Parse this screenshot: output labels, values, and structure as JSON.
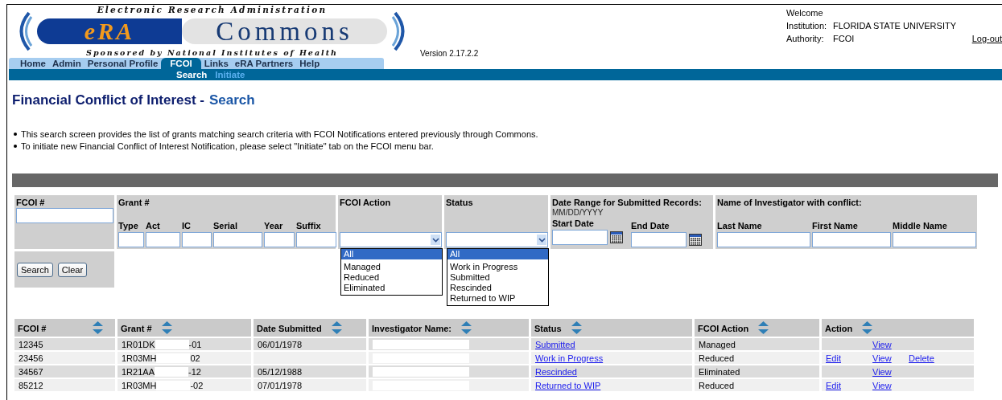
{
  "header": {
    "logo": {
      "top_line": "Electronic Research Administration",
      "brand": "eRA",
      "name": "Commons",
      "sponsor": "Sponsored by National Institutes of Health"
    },
    "version": "Version 2.17.2.2",
    "user": {
      "welcome": "Welcome",
      "institution_label": "Institution:",
      "institution": "FLORIDA STATE UNIVERSITY",
      "authority_label": "Authority:",
      "authority": "FCOI",
      "logout": "Log-out"
    }
  },
  "tabs": [
    {
      "label": "Home",
      "selected": false
    },
    {
      "label": "Admin",
      "selected": false
    },
    {
      "label": "Personal Profile",
      "selected": false
    },
    {
      "label": "FCOI",
      "selected": true
    },
    {
      "label": "Links",
      "selected": false
    },
    {
      "label": "eRA Partners",
      "selected": false
    },
    {
      "label": "Help",
      "selected": false
    }
  ],
  "subtabs": [
    {
      "label": "Search",
      "selected": true
    },
    {
      "label": "Initiate",
      "selected": false
    }
  ],
  "page_title": {
    "main": "Financial Conflict of Interest -",
    "section": "Search"
  },
  "instructions": [
    "This search screen provides the list of grants matching search criteria with FCOI Notifications entered previously through Commons.",
    "To initiate new Financial Conflict of Interest Notification, please select \"Initiate\" tab on the FCOI menu bar."
  ],
  "search_form": {
    "fcoi": {
      "label": "FCOI #"
    },
    "grant": {
      "label": "Grant #",
      "parts": [
        "Type",
        "Act",
        "IC",
        "Serial",
        "Year",
        "Suffix"
      ]
    },
    "fcoi_action": {
      "label": "FCOI Action",
      "options": [
        {
          "label": "All",
          "selected": true
        },
        {
          "label": "Managed",
          "selected": false
        },
        {
          "label": "Reduced",
          "selected": false
        },
        {
          "label": "Eliminated",
          "selected": false
        }
      ]
    },
    "status": {
      "label": "Status",
      "options": [
        {
          "label": "All",
          "selected": true
        },
        {
          "label": "Work in Progress",
          "selected": false
        },
        {
          "label": "Submitted",
          "selected": false
        },
        {
          "label": "Rescinded",
          "selected": false
        },
        {
          "label": "Returned to WIP",
          "selected": false
        }
      ]
    },
    "date_range": {
      "label": "Date Range for Submitted Records:",
      "format": "MM/DD/YYYY",
      "start_label": "Start Date",
      "end_label": "End Date"
    },
    "investigator": {
      "label": "Name of Investigator with conflict:",
      "parts": [
        "Last Name",
        "First Name",
        "Middle Name"
      ]
    },
    "buttons": [
      "Search",
      "Clear"
    ]
  },
  "results": {
    "columns": [
      "FCOI #",
      "Grant #",
      "Date Submitted",
      "Investigator Name:",
      "Status",
      "FCOI Action",
      "Action"
    ],
    "rows": [
      {
        "fcoi": "12345",
        "grant_prefix": "1R01DK",
        "grant_suffix": "-01",
        "date": "06/01/1978",
        "status": "Submitted",
        "fcoi_action": "Managed",
        "actions": [
          {
            "kind": "view",
            "label": "View"
          }
        ]
      },
      {
        "fcoi": "23456",
        "grant_prefix": "1R03MH",
        "grant_suffix": "02",
        "status": "Work in Progress",
        "fcoi_action": "Reduced",
        "actions": [
          {
            "kind": "edit",
            "label": "Edit"
          },
          {
            "kind": "view",
            "label": "View"
          },
          {
            "kind": "delete",
            "label": "Delete"
          }
        ]
      },
      {
        "fcoi": "34567",
        "grant_prefix": "1R21AA",
        "grant_suffix": "-12",
        "date": "05/12/1988",
        "status": "Rescinded",
        "fcoi_action": "Eliminated",
        "actions": [
          {
            "kind": "view",
            "label": "View"
          }
        ]
      },
      {
        "fcoi": "85212",
        "grant_prefix": "1R03MH",
        "grant_suffix": "-02",
        "date": "07/01/1978",
        "status": "Returned to WIP",
        "fcoi_action": "Reduced",
        "actions": [
          {
            "kind": "edit",
            "label": "Edit"
          },
          {
            "kind": "view",
            "label": "View"
          }
        ]
      }
    ]
  }
}
